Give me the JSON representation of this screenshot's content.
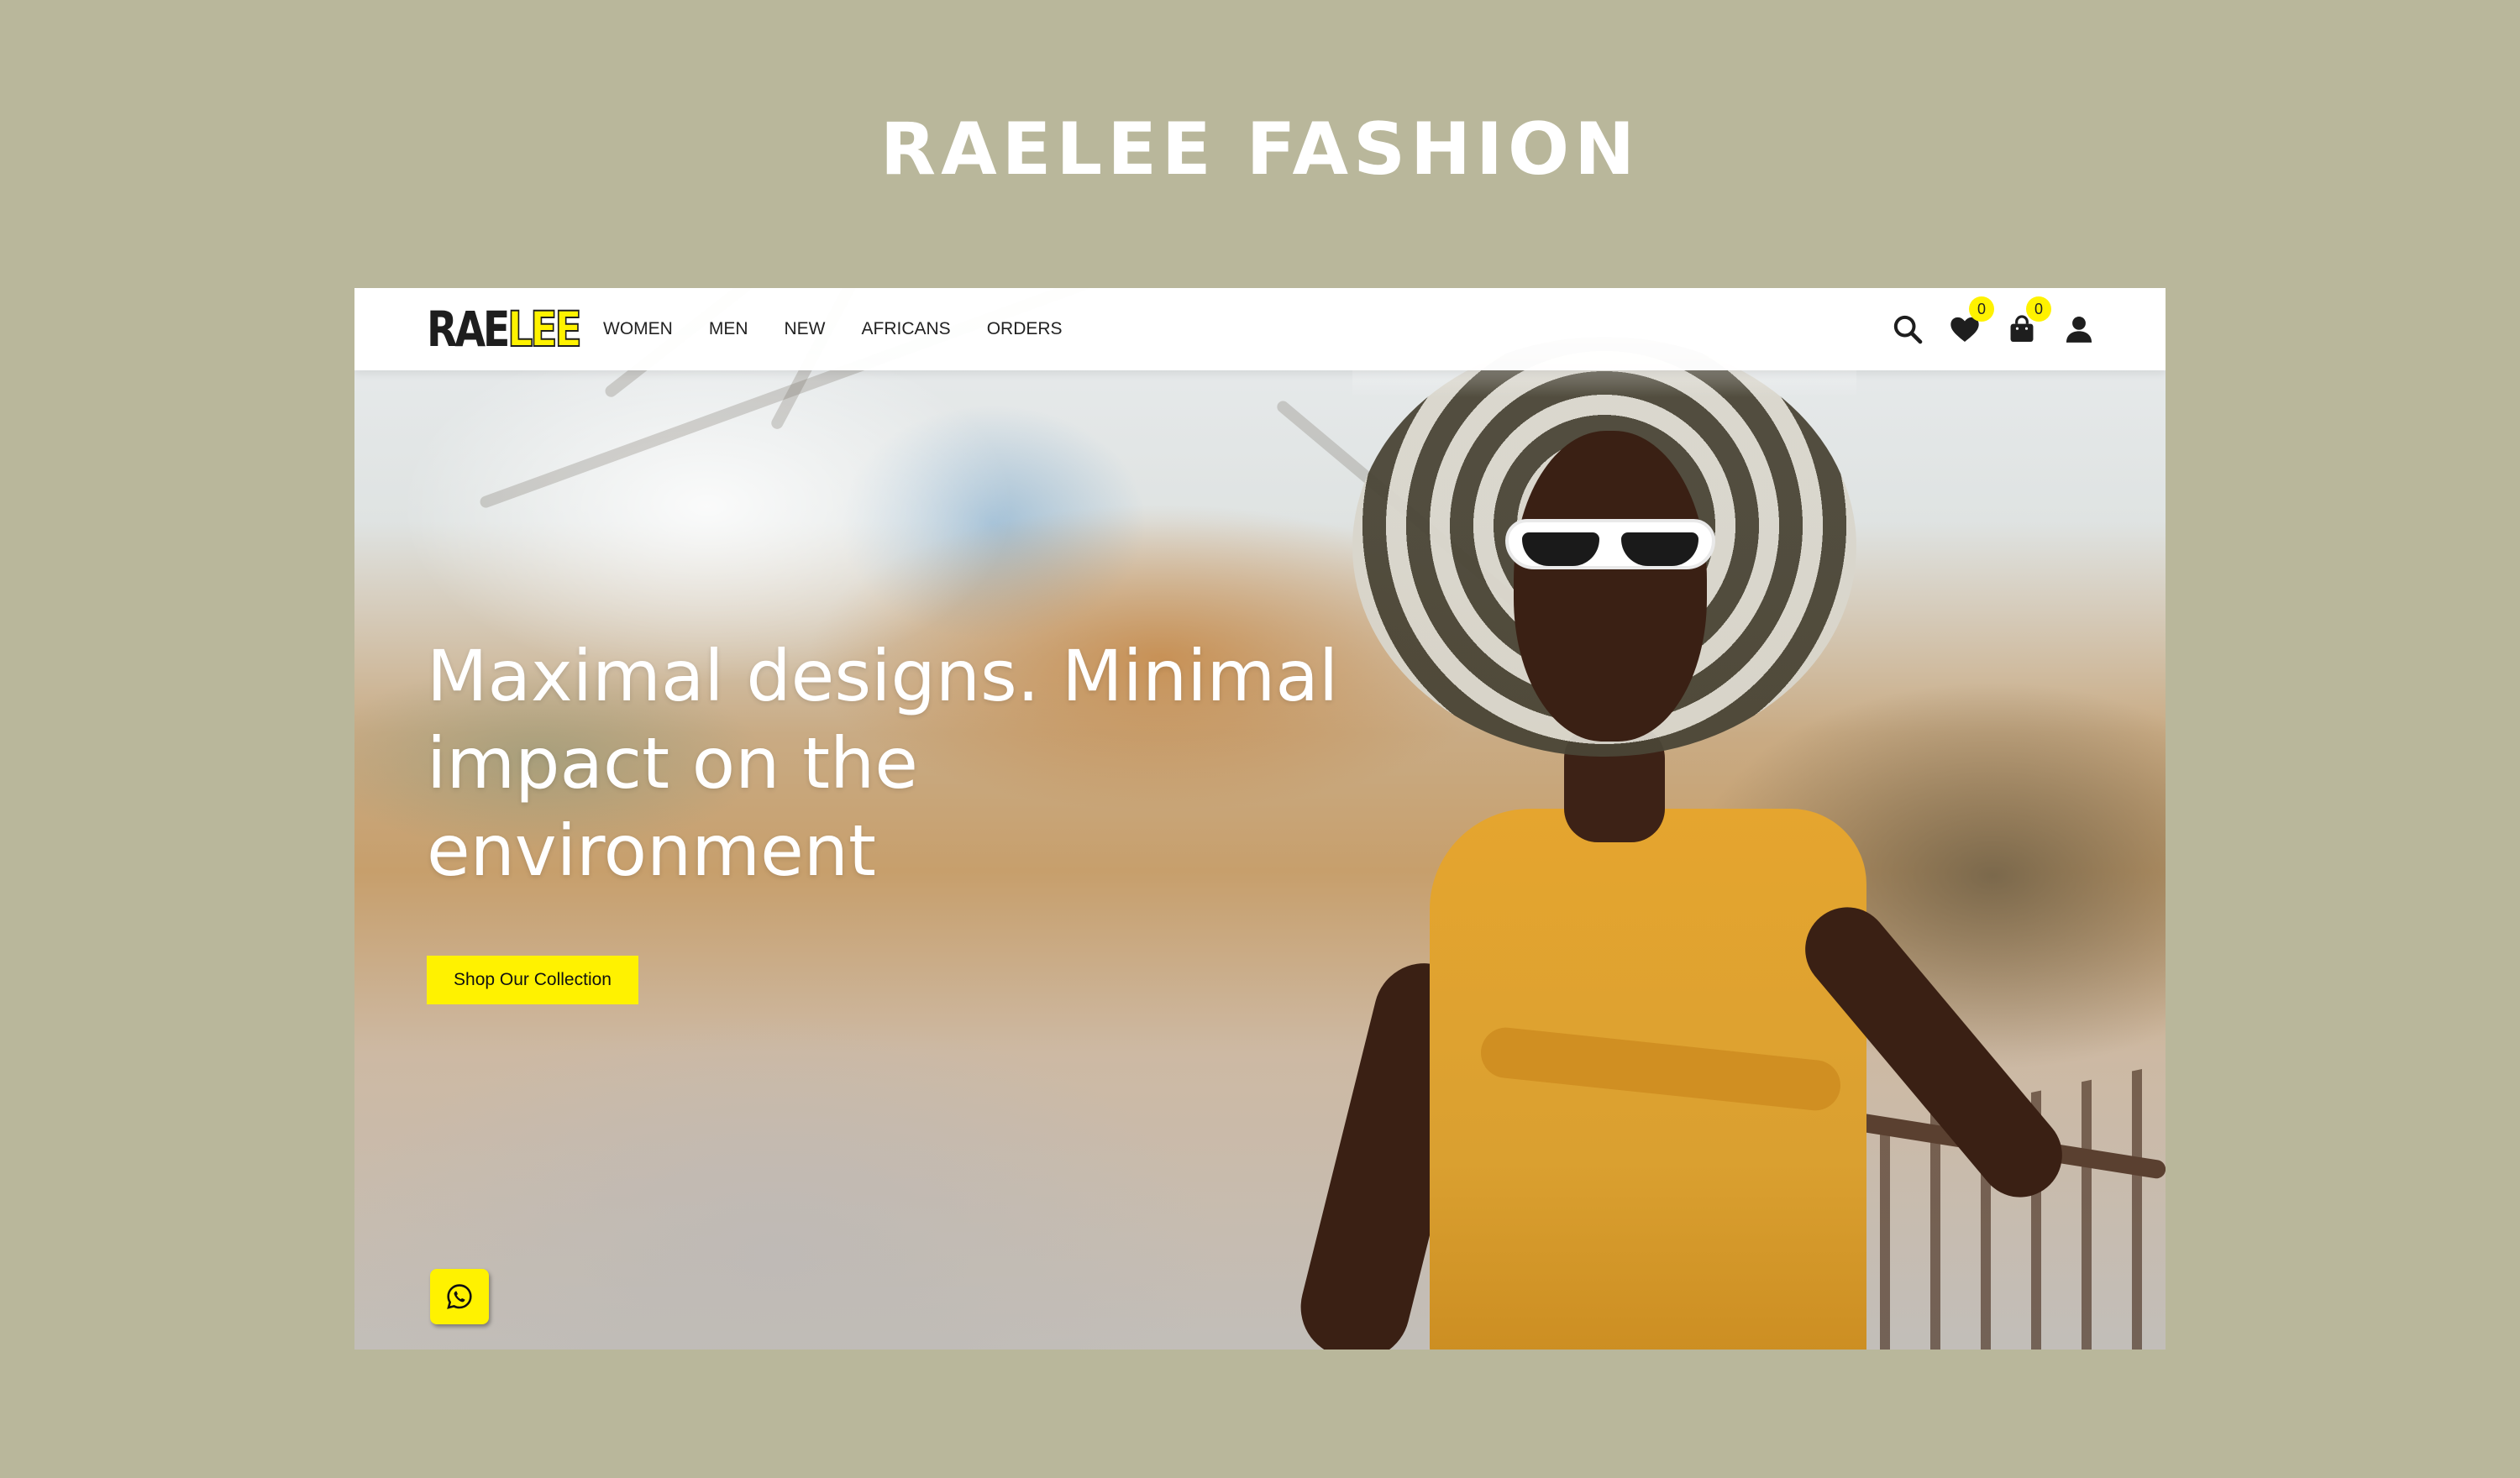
{
  "showcase": {
    "title": "RAELEE FASHION"
  },
  "brand": {
    "logo_dark": "RAE",
    "logo_accent": "LEE",
    "accent_color": "#fff200",
    "background_color": "#b9b79b"
  },
  "nav": {
    "links": [
      "WOMEN",
      "MEN",
      "NEW",
      "AFRICANS",
      "ORDERS"
    ],
    "icons": [
      "search-icon",
      "heart-icon",
      "shopping-bag-icon",
      "user-icon"
    ],
    "wishlist_count": "0",
    "cart_count": "0"
  },
  "hero": {
    "headline": "Maximal designs. Minimal impact on the environment",
    "cta_label": "Shop Our Collection",
    "chat_icon": "whatsapp-icon"
  }
}
